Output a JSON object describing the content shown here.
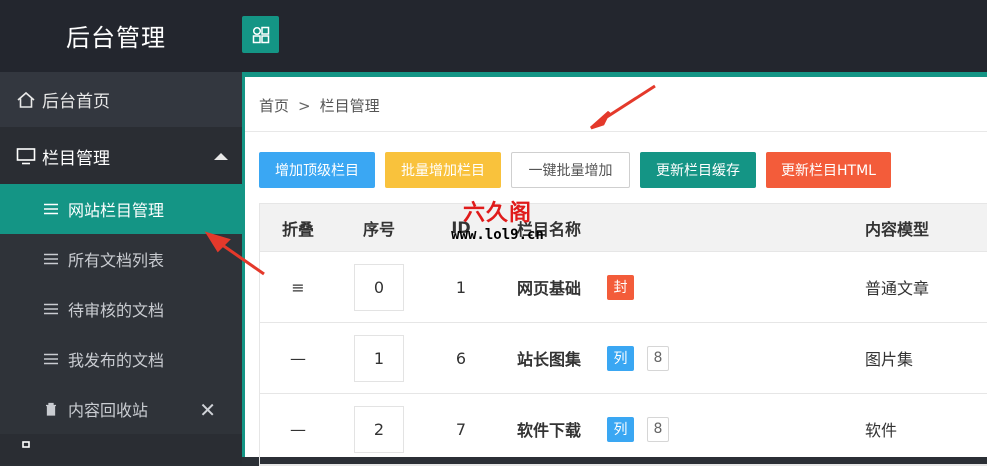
{
  "app": {
    "title": "后台管理"
  },
  "sidebar": {
    "home": "后台首页",
    "group": "栏目管理",
    "items": [
      {
        "label": "网站栏目管理",
        "active": true
      },
      {
        "label": "所有文档列表",
        "active": false
      },
      {
        "label": "待审核的文档",
        "active": false
      },
      {
        "label": "我发布的文档",
        "active": false
      },
      {
        "label": "内容回收站",
        "active": false
      }
    ],
    "close_glyph": "✕"
  },
  "breadcrumb": {
    "home": "首页",
    "sep": ">",
    "current": "栏目管理"
  },
  "toolbar": {
    "add_top": "增加顶级栏目",
    "batch_add": "批量增加栏目",
    "one_click": "一键批量增加",
    "update_cache": "更新栏目缓存",
    "update_html": "更新栏目HTML"
  },
  "table": {
    "headers": {
      "fold": "折叠",
      "seq": "序号",
      "id": "ID",
      "name": "栏目名称",
      "model": "内容模型"
    },
    "rows": [
      {
        "fold": "≡",
        "seq": "0",
        "id": "1",
        "name": "网页基础",
        "tag": "封",
        "tag_color": "#f35c3a",
        "count": "",
        "model": "普通文章"
      },
      {
        "fold": "—",
        "seq": "1",
        "id": "6",
        "name": "站长图集",
        "tag": "列",
        "tag_color": "#3aa7f3",
        "count": "8",
        "model": "图片集"
      },
      {
        "fold": "—",
        "seq": "2",
        "id": "7",
        "name": "软件下载",
        "tag": "列",
        "tag_color": "#3aa7f3",
        "count": "8",
        "model": "软件"
      }
    ]
  },
  "watermark": {
    "cn": "六久阁",
    "url": "www.lol9.cn"
  },
  "colors": {
    "accent": "#149585",
    "blue": "#3aa7f3",
    "yellow": "#f9c23c",
    "red": "#f35c3a",
    "sidebar": "#33373f",
    "topbar": "#23262e"
  }
}
